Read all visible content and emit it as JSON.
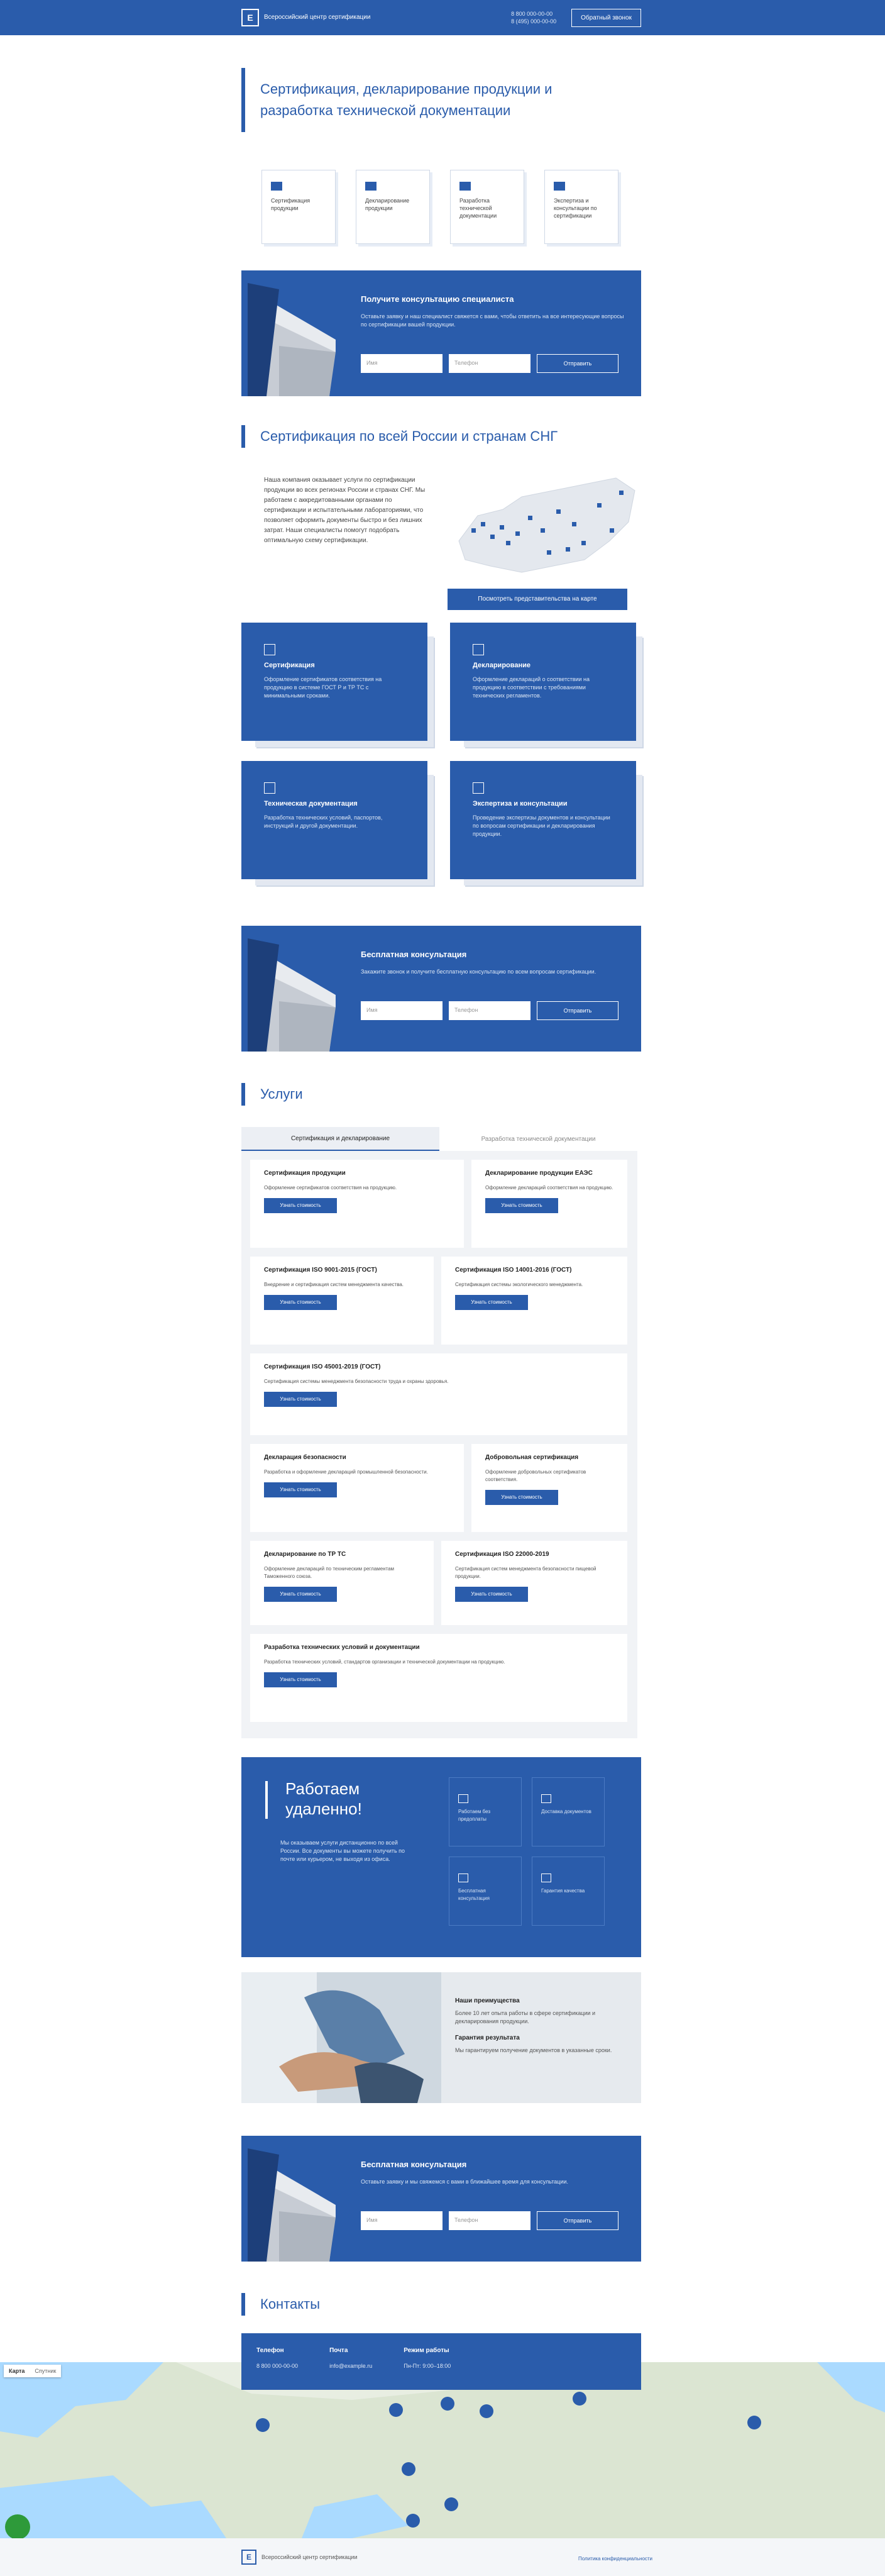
{
  "header": {
    "logo_letter": "Е",
    "company": "Всероссийский центр сертификации",
    "phone_line1": "8 800 000-00-00",
    "phone_line2": "8 (495) 000-00-00",
    "button": "Обратный звонок"
  },
  "hero": {
    "title": "Сертификация, декларирование продукции и разработка технической документации"
  },
  "features": [
    {
      "text": "Сертификация продукции",
      "icon": "cert-icon"
    },
    {
      "text": "Декларирование продукции",
      "icon": "doc-icon"
    },
    {
      "text": "Разработка технической документации",
      "icon": "book-icon"
    },
    {
      "text": "Экспертиза и консультации по сертификации",
      "icon": "check-icon"
    }
  ],
  "cta_1": {
    "title": "Получите консультацию специалиста",
    "text": "Оставьте заявку и наш специалист свяжется с вами, чтобы ответить на все интересующие вопросы по сертификации вашей продукции.",
    "name_placeholder": "Имя",
    "phone_placeholder": "Телефон",
    "button": "Отправить"
  },
  "certification": {
    "title": "Сертификация по всей России и странам СНГ",
    "text": "Наша компания оказывает услуги по сертификации продукции во всех регионах России и странах СНГ. Мы работаем с аккредитованными органами по сертификации и испытательными лабораториями, что позволяет оформить документы быстро и без лишних затрат. Наши специалисты помогут подобрать оптимальную схему сертификации.",
    "map_button": "Посмотреть представительства на карте"
  },
  "cards": [
    {
      "title": "Сертификация",
      "text": "Оформление сертификатов соответствия на продукцию в системе ГОСТ Р и ТР ТС с минимальными сроками.",
      "icon": "stamp-icon"
    },
    {
      "title": "Декларирование",
      "text": "Оформление деклараций о соответствии на продукцию в соответствии с требованиями технических регламентов.",
      "icon": "doc-icon"
    },
    {
      "title": "Техническая документация",
      "text": "Разработка технических условий, паспортов, инструкций и другой документации.",
      "icon": "book-icon"
    },
    {
      "title": "Экспертиза и консультации",
      "text": "Проведение экспертизы документов и консультации по вопросам сертификации и декларирования продукции.",
      "icon": "chat-icon"
    }
  ],
  "cta_2": {
    "title": "Бесплатная консультация",
    "text": "Закажите звонок и получите бесплатную консультацию по всем вопросам сертификации.",
    "name_placeholder": "Имя",
    "phone_placeholder": "Телефон",
    "button": "Отправить"
  },
  "services": {
    "title": "Услуги",
    "tab_active": "Сертификация и декларирование",
    "tab_inactive": "Разработка технической документации",
    "items": [
      {
        "title": "Сертификация продукции",
        "text": "Оформление сертификатов соответствия на продукцию.",
        "button": "Узнать стоимость"
      },
      {
        "title": "Декларирование продукции ЕАЭС",
        "text": "Оформление деклараций соответствия на продукцию.",
        "button": "Узнать стоимость"
      },
      {
        "title": "Сертификация ISO 9001-2015 (ГОСТ)",
        "text": "Внедрение и сертификация систем менеджмента качества.",
        "button": "Узнать стоимость"
      },
      {
        "title": "Сертификация ISO 14001-2016 (ГОСТ)",
        "text": "Сертификация системы экологического менеджмента.",
        "button": "Узнать стоимость"
      },
      {
        "title": "Сертификация ISO 45001-2019 (ГОСТ)",
        "text": "Сертификация системы менеджмента безопасности труда и охраны здоровья.",
        "button": "Узнать стоимость"
      },
      {
        "title": "Декларация безопасности",
        "text": "Разработка и оформление деклараций промышленной безопасности.",
        "button": "Узнать стоимость"
      },
      {
        "title": "Добровольная сертификация",
        "text": "Оформление добровольных сертификатов соответствия.",
        "button": "Узнать стоимость"
      },
      {
        "title": "Декларирование по ТР ТС",
        "text": "Оформление деклараций по техническим регламентам Таможенного союза.",
        "button": "Узнать стоимость"
      },
      {
        "title": "Сертификация ISO 22000-2019",
        "text": "Сертификация систем менеджмента безопасности пищевой продукции.",
        "button": "Узнать стоимость"
      },
      {
        "title": "Разработка технических условий и документации",
        "text": "Разработка технических условий, стандартов организации и технической документации на продукцию.",
        "button": "Узнать стоимость"
      }
    ]
  },
  "why": {
    "title": "Работаем удаленно!",
    "text": "Мы оказываем услуги дистанционно по всей России. Все документы вы можете получить по почте или курьером, не выходя из офиса.",
    "items": [
      {
        "text": "Работаем без предоплаты",
        "icon": "wallet-icon"
      },
      {
        "text": "Доставка документов",
        "icon": "truck-icon"
      },
      {
        "text": "Бесплатная консультация",
        "icon": "phone-icon"
      },
      {
        "text": "Гарантия качества",
        "icon": "shield-icon"
      }
    ]
  },
  "partner": {
    "title1": "Наши преимущества",
    "text1": "Более 10 лет опыта работы в сфере сертификации и декларирования продукции.",
    "title2": "Гарантия результата",
    "text2": "Мы гарантируем получение документов в указанные сроки."
  },
  "cta_3": {
    "title": "Бесплатная консультация",
    "text": "Оставьте заявку и мы свяжемся с вами в ближайшее время для консультации.",
    "name_placeholder": "Имя",
    "phone_placeholder": "Телефон",
    "button": "Отправить"
  },
  "contacts": {
    "title": "Контакты",
    "phone_label": "Телефон",
    "phone_value": "8 800 000-00-00",
    "email_label": "Почта",
    "email_value": "info@example.ru",
    "hours_label": "Режим работы",
    "hours_value": "Пн-Пт: 9:00–18:00"
  },
  "map": {
    "type_map": "Карта",
    "type_sat": "Спутник"
  },
  "footer": {
    "logo_letter": "Е",
    "company": "Всероссийский центр сертификации",
    "right": "Политика конфиденциальности"
  }
}
